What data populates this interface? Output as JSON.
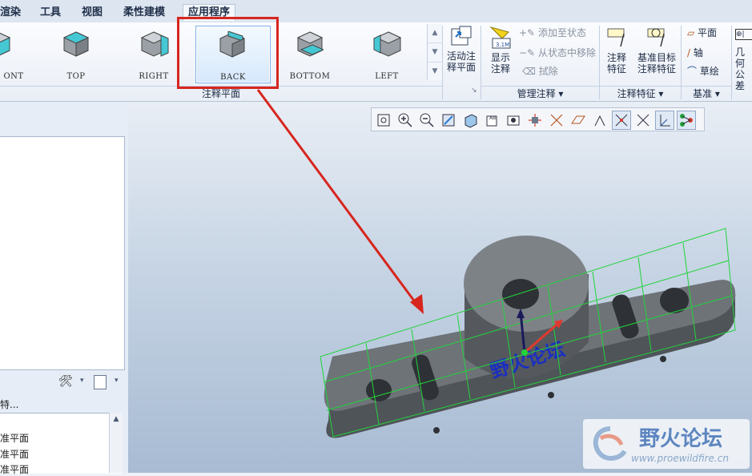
{
  "menu_tabs": [
    "渲染",
    "工具",
    "视图",
    "柔性建模",
    "应用程序"
  ],
  "ribbon": {
    "views": [
      {
        "label": "FRONT",
        "shown": "ONT"
      },
      {
        "label": "TOP"
      },
      {
        "label": "RIGHT"
      },
      {
        "label": "BACK",
        "selected": true
      },
      {
        "label": "BOTTOM"
      },
      {
        "label": "LEFT"
      }
    ],
    "group_views_label": "注释平面",
    "activate_annotation_plane": "活动注\n释平面",
    "show_annotation": "显示\n注释",
    "add_to_state": "添加至状态",
    "remove_from_state": "从状态中移除",
    "erase": "拭除",
    "group_manage_label": "管理注释",
    "annotation_feature": "注释\n特征",
    "datum_target_annotation_feature": "基准目标\n注释特征",
    "group_annot_feature_label": "注释特征",
    "datum_plane": "平面",
    "datum_axis": "轴",
    "sketch": "草绘",
    "group_datum_label": "基准",
    "geometric_tolerance_partial": "几何\n公差"
  },
  "left_panel": {
    "lower_header_partial": "特...",
    "tree_items": [
      "基准平面",
      "基准平面",
      "基准平面"
    ]
  },
  "model_text": "野火论坛",
  "watermark": {
    "title": "野火论坛",
    "url": "www.proewildfire.cn"
  },
  "colors": {
    "highlight_red": "#d7261f",
    "grid_green": "#22d33b",
    "model_gray": "#6e7378"
  }
}
